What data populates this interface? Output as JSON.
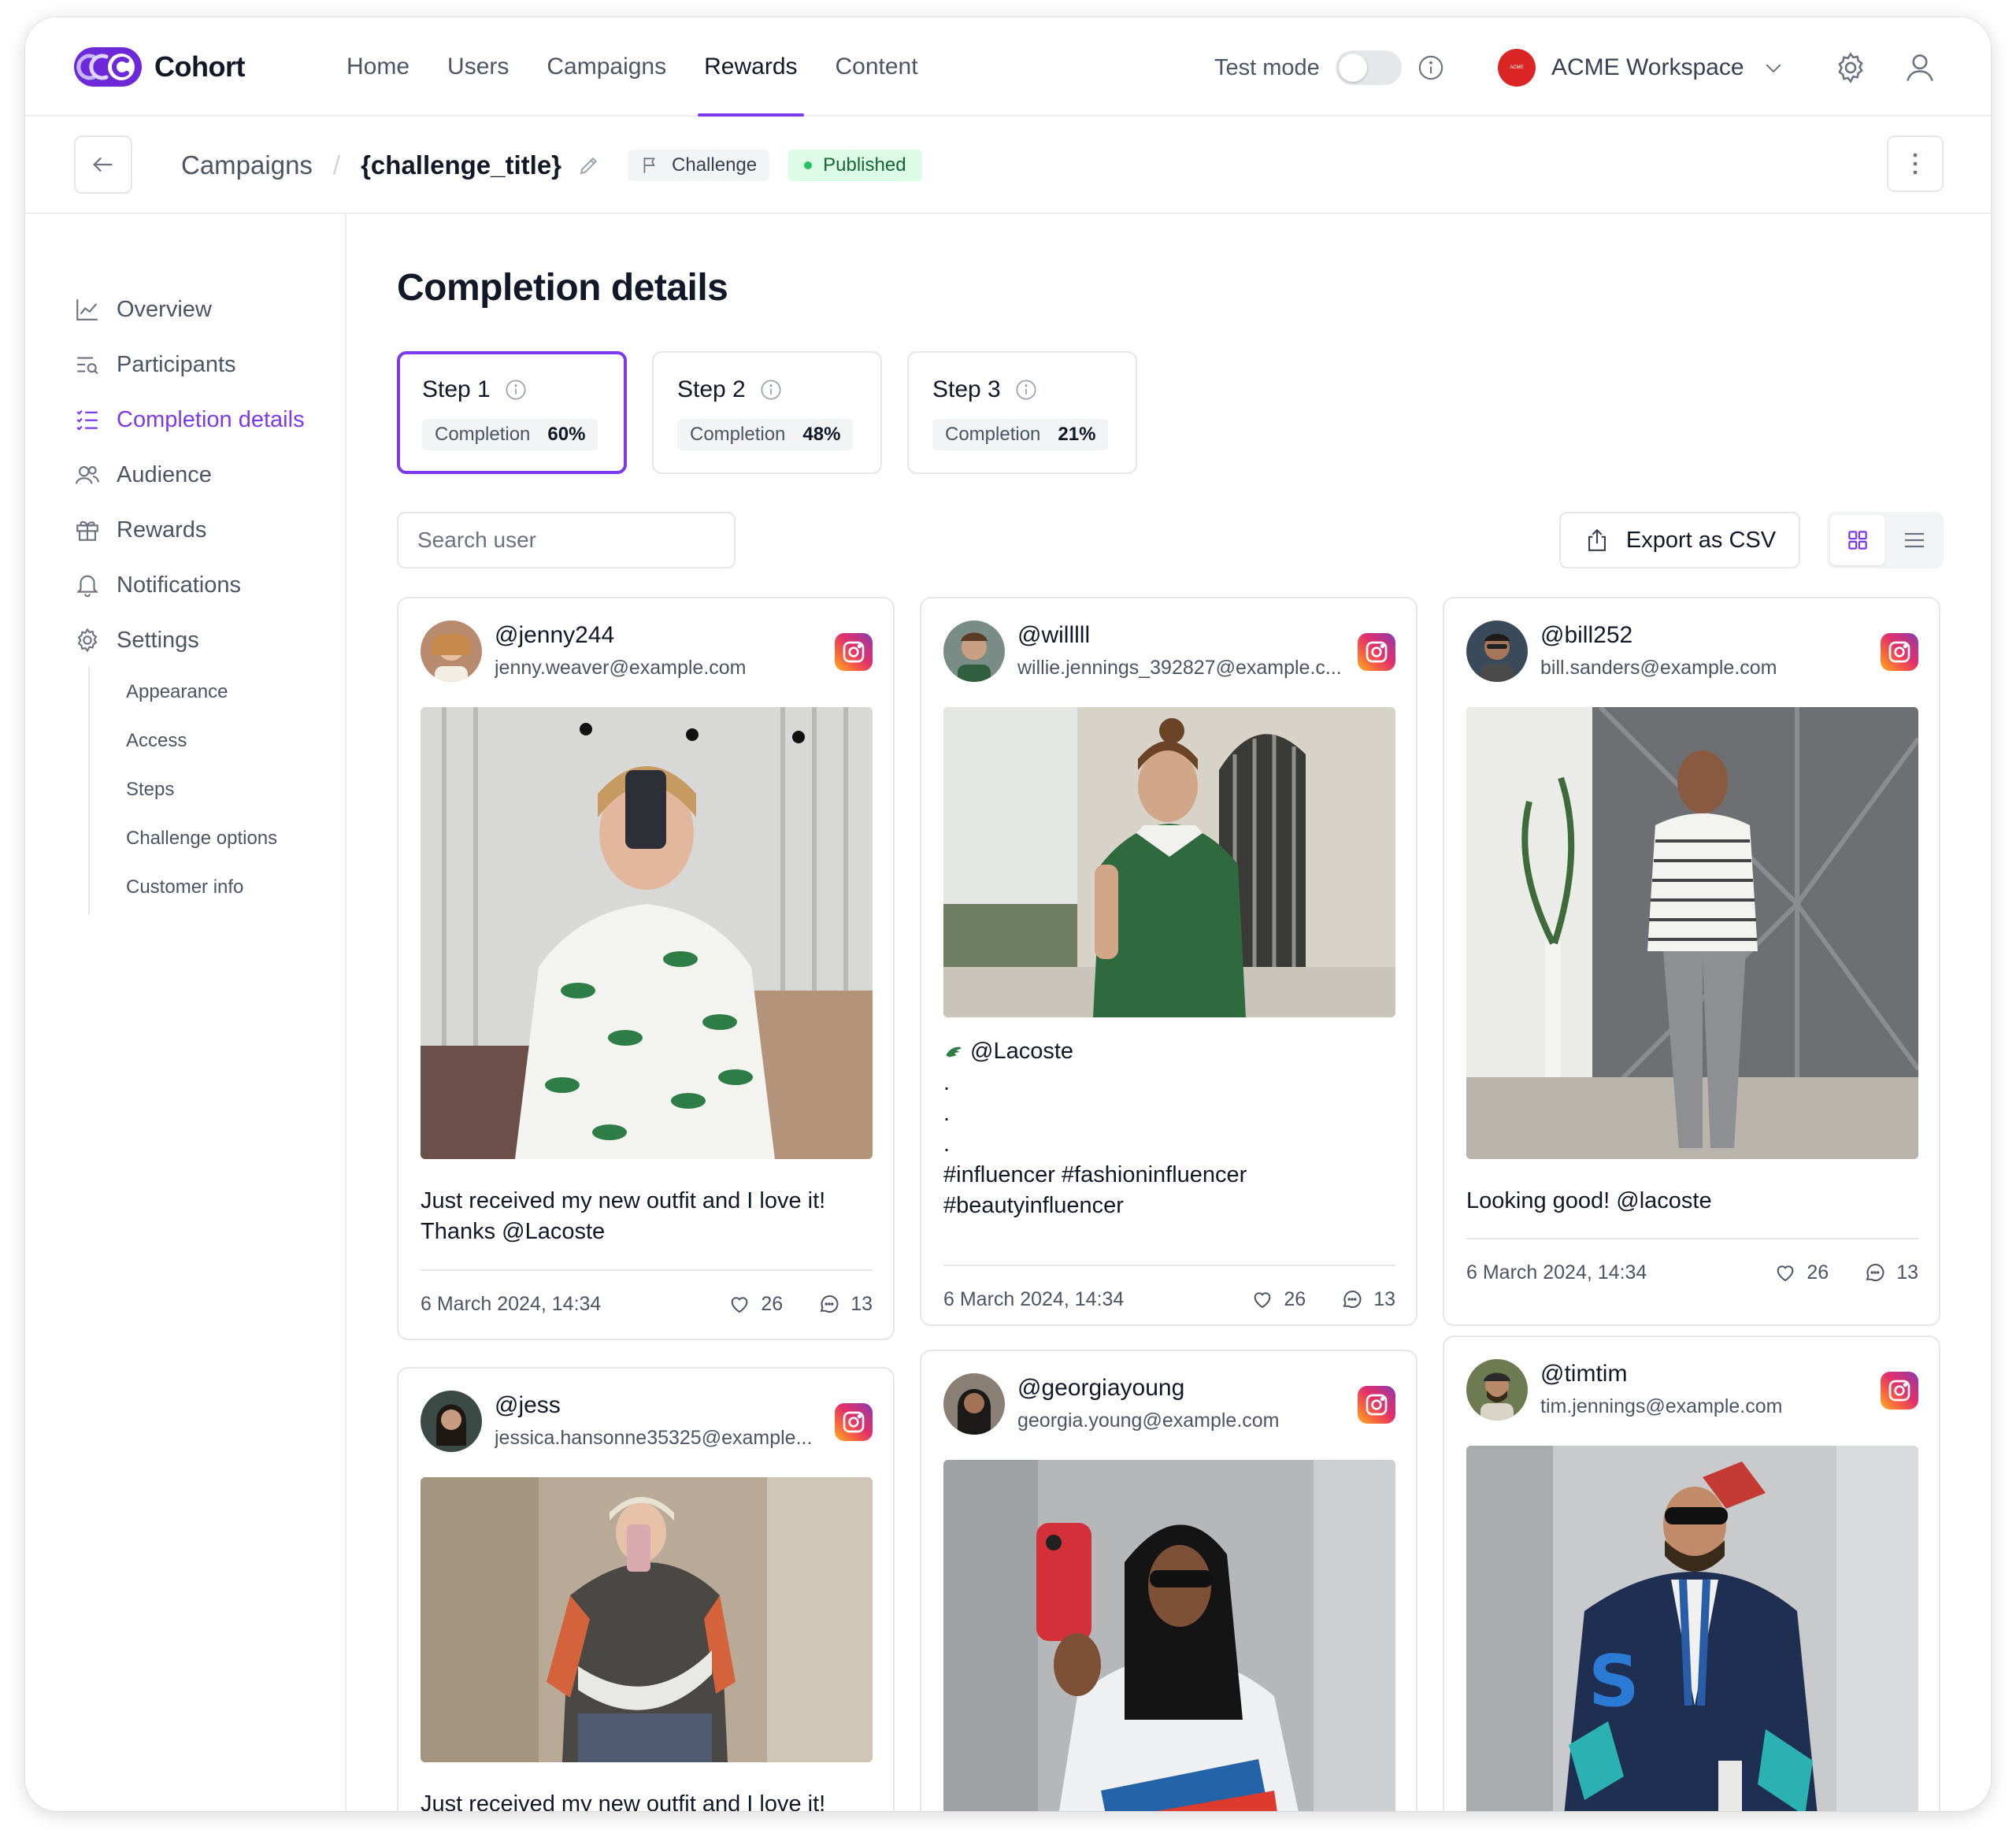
{
  "app": {
    "name": "Cohort"
  },
  "nav": {
    "links": [
      {
        "label": "Home"
      },
      {
        "label": "Users"
      },
      {
        "label": "Campaigns"
      },
      {
        "label": "Rewards"
      },
      {
        "label": "Content"
      }
    ],
    "active": "Rewards",
    "test_mode_label": "Test mode",
    "workspace_name": "ACME Workspace",
    "workspace_avatar_text": "ACME"
  },
  "header": {
    "breadcrumb_parent": "Campaigns",
    "breadcrumb_sep": "/",
    "title": "{challenge_title}",
    "type_chip": "Challenge",
    "status_chip": "Published"
  },
  "sidebar": {
    "items": [
      {
        "label": "Overview",
        "icon": "chart-line-icon"
      },
      {
        "label": "Participants",
        "icon": "list-search-icon"
      },
      {
        "label": "Completion details",
        "icon": "checklist-icon"
      },
      {
        "label": "Audience",
        "icon": "users-icon"
      },
      {
        "label": "Rewards",
        "icon": "gift-icon"
      },
      {
        "label": "Notifications",
        "icon": "bell-icon"
      },
      {
        "label": "Settings",
        "icon": "gear-icon"
      }
    ],
    "active": "Completion details",
    "sub_items": [
      {
        "label": "Appearance"
      },
      {
        "label": "Access"
      },
      {
        "label": "Steps"
      },
      {
        "label": "Challenge options"
      },
      {
        "label": "Customer info"
      }
    ]
  },
  "main": {
    "title": "Completion details",
    "steps": [
      {
        "label": "Step 1",
        "completion_label": "Completion",
        "completion": "60%"
      },
      {
        "label": "Step 2",
        "completion_label": "Completion",
        "completion": "48%"
      },
      {
        "label": "Step 3",
        "completion_label": "Completion",
        "completion": "21%"
      }
    ],
    "search_placeholder": "Search user",
    "export_label": "Export as CSV"
  },
  "posts": [
    {
      "handle": "@jenny244",
      "email": "jenny.weaver@example.com",
      "caption": "Just received my new outfit and I love it!\nThanks @Lacoste",
      "date": "6 March 2024, 14:34",
      "likes": "26",
      "comments": "13"
    },
    {
      "handle": "@willlll",
      "email": "willie.jennings_392827@example.c...",
      "caption_lead": "@Lacoste",
      "caption": ".\n.\n.\n#influencer #fashioninfluencer\n#beautyinfluencer",
      "date": "6 March 2024, 14:34",
      "likes": "26",
      "comments": "13"
    },
    {
      "handle": "@bill252",
      "email": "bill.sanders@example.com",
      "caption": "Looking good! @lacoste",
      "date": "6 March 2024, 14:34",
      "likes": "26",
      "comments": "13"
    },
    {
      "handle": "@jess",
      "email": "jessica.hansonne35325@example...",
      "caption": "Just received my new outfit and I love it!"
    },
    {
      "handle": "@georgiayoung",
      "email": "georgia.young@example.com"
    },
    {
      "handle": "@timtim",
      "email": "tim.jennings@example.com"
    }
  ],
  "colors": {
    "accent": "#7c3aed",
    "published_bg": "#dcfce7",
    "published_text": "#166534"
  }
}
